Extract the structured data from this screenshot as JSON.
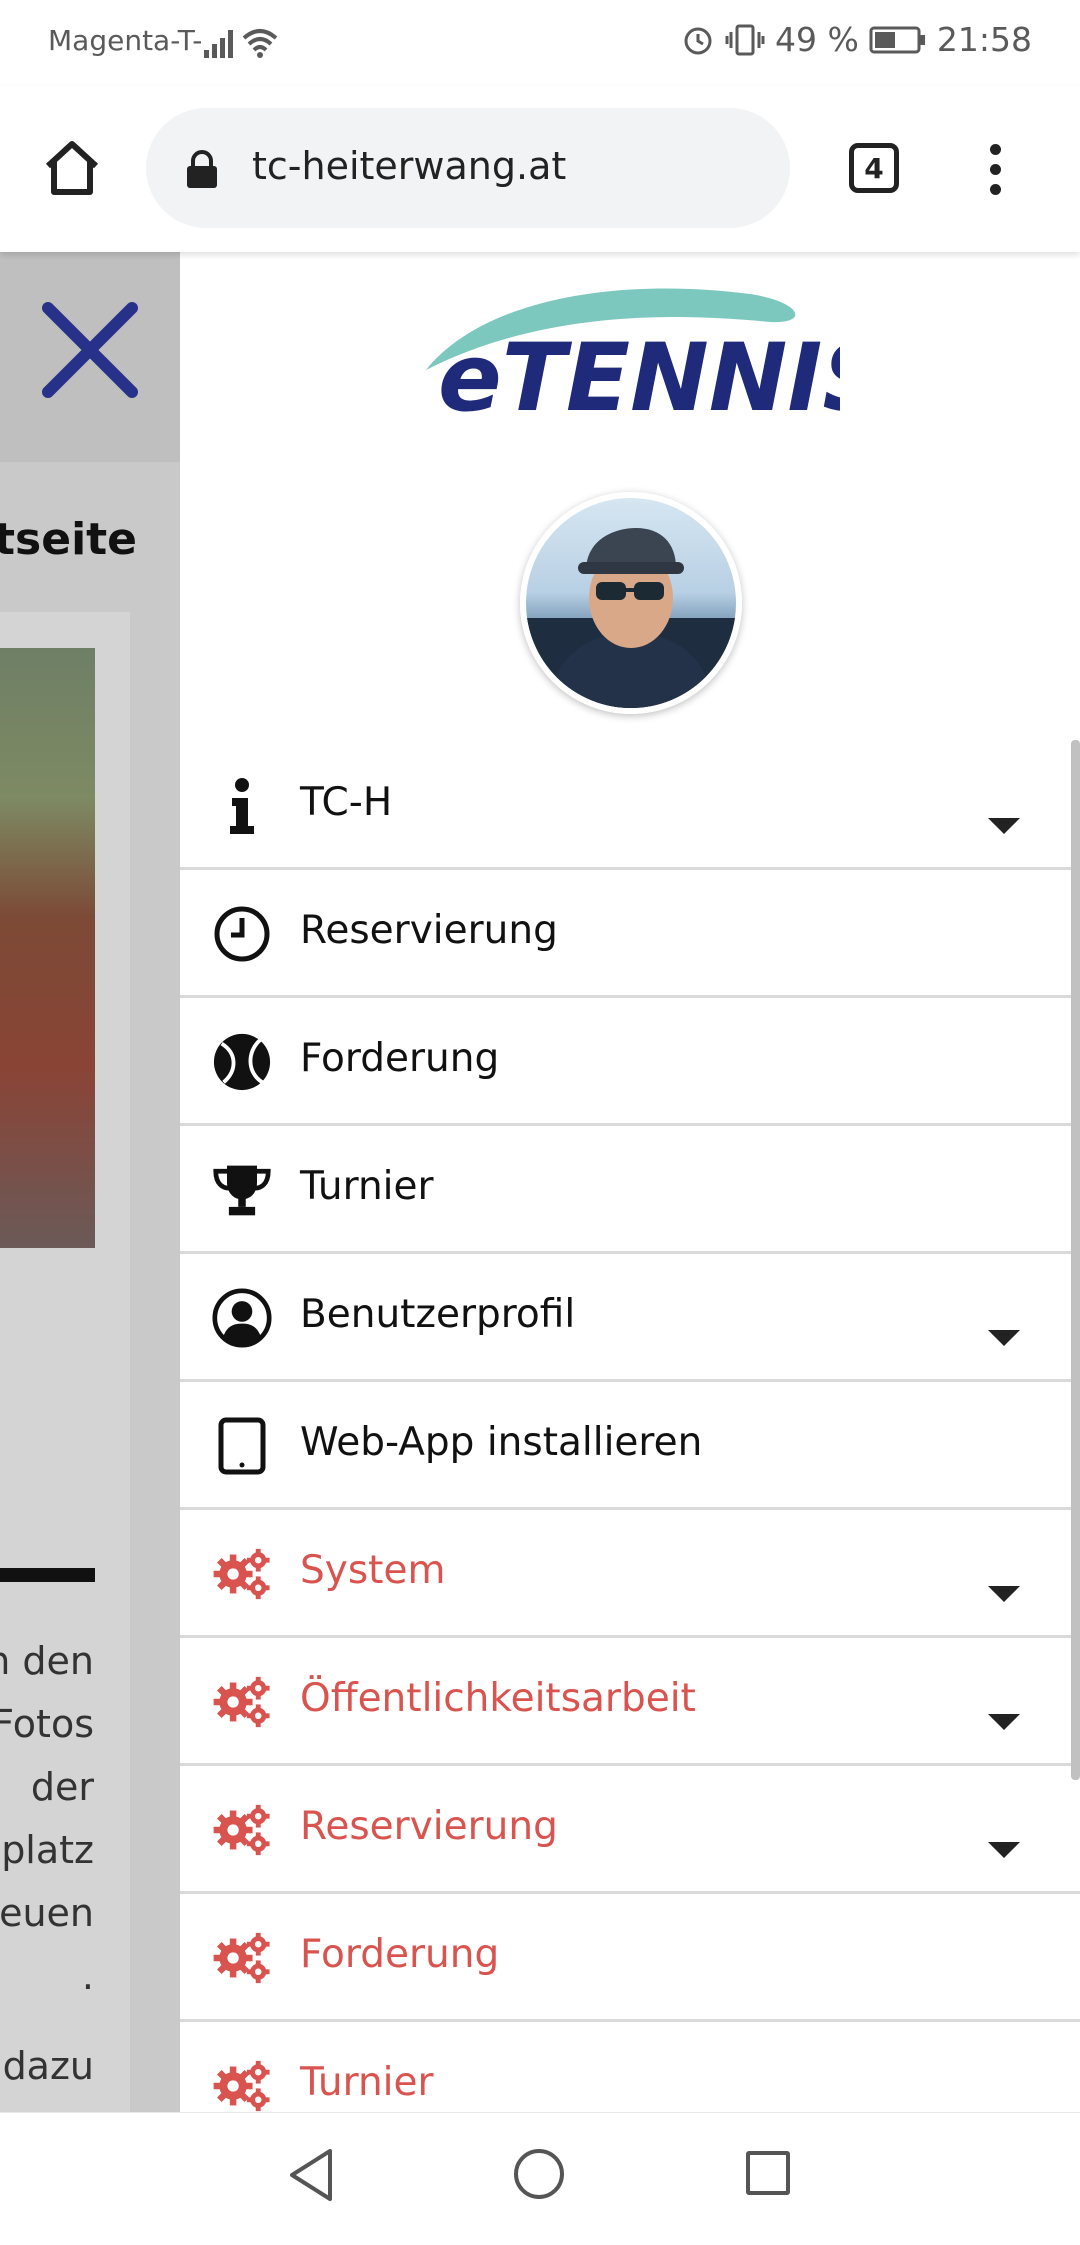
{
  "status_bar": {
    "carrier": "Magenta-T-",
    "battery": "49 %",
    "time": "21:58"
  },
  "browser": {
    "url": "tc-heiterwang.at",
    "tab_count": "4"
  },
  "background_page": {
    "heading": "tseite",
    "text_lines": [
      "n den",
      "Fotos",
      "der",
      "platz",
      "euen",
      "."
    ],
    "text_bottom": "dazu"
  },
  "drawer": {
    "logo_text": "eTENNIS",
    "menu": [
      {
        "label": "TC-H",
        "icon": "info-icon",
        "has_submenu": true,
        "color": "#111111"
      },
      {
        "label": "Reservierung",
        "icon": "clock-icon",
        "has_submenu": false,
        "color": "#111111"
      },
      {
        "label": "Forderung",
        "icon": "tennis-ball-icon",
        "has_submenu": false,
        "color": "#111111"
      },
      {
        "label": "Turnier",
        "icon": "trophy-icon",
        "has_submenu": false,
        "color": "#111111"
      },
      {
        "label": "Benutzerprofil",
        "icon": "user-circle-icon",
        "has_submenu": true,
        "color": "#111111"
      },
      {
        "label": "Web-App installieren",
        "icon": "tablet-icon",
        "has_submenu": false,
        "color": "#111111"
      },
      {
        "label": "System",
        "icon": "gears-icon",
        "has_submenu": true,
        "color": "#d9534f"
      },
      {
        "label": "Öffentlichkeitsarbeit",
        "icon": "gears-icon",
        "has_submenu": true,
        "color": "#d9534f"
      },
      {
        "label": "Reservierung",
        "icon": "gears-icon",
        "has_submenu": true,
        "color": "#d9534f"
      },
      {
        "label": "Forderung",
        "icon": "gears-icon",
        "has_submenu": false,
        "color": "#d9534f"
      },
      {
        "label": "Turnier",
        "icon": "gears-icon",
        "has_submenu": false,
        "color": "#d9534f"
      }
    ]
  },
  "colors": {
    "admin_red": "#d9534f",
    "logo_navy": "#1f2a7a",
    "logo_swoosh": "#7cc8bf"
  }
}
